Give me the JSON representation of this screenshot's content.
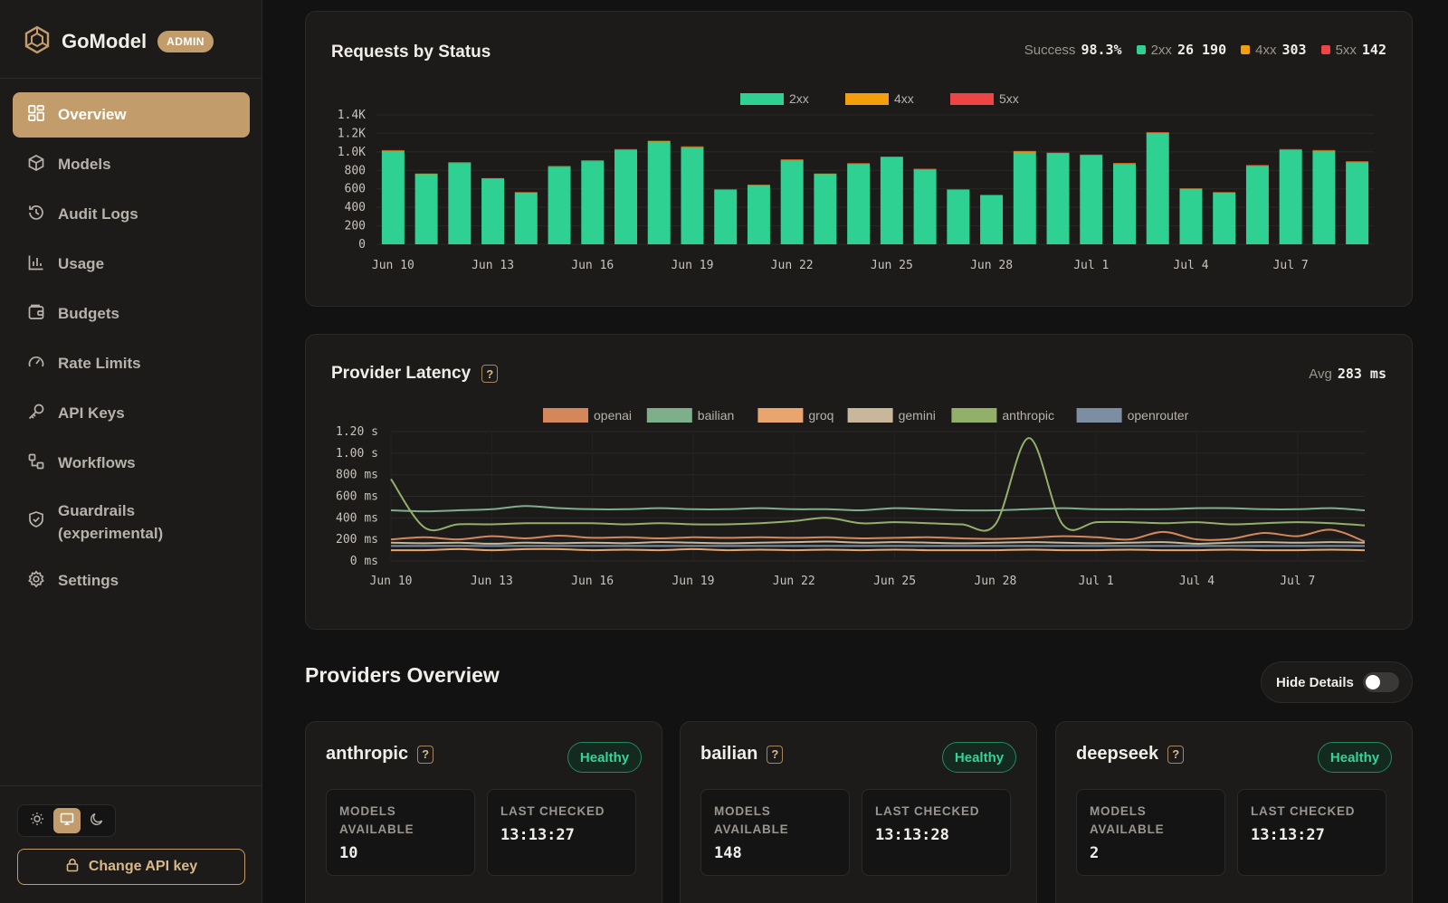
{
  "brand": {
    "name": "GoModel",
    "badge": "ADMIN"
  },
  "sidebar": {
    "items": [
      {
        "label": "Overview",
        "icon": "grid-icon",
        "active": true
      },
      {
        "label": "Models",
        "icon": "cube-icon"
      },
      {
        "label": "Audit Logs",
        "icon": "history-icon"
      },
      {
        "label": "Usage",
        "icon": "bar-chart-icon"
      },
      {
        "label": "Budgets",
        "icon": "wallet-icon"
      },
      {
        "label": "Rate Limits",
        "icon": "gauge-icon"
      },
      {
        "label": "API Keys",
        "icon": "key-icon"
      },
      {
        "label": "Workflows",
        "icon": "workflow-icon"
      },
      {
        "label": "Guardrails (experimental)",
        "line1": "Guardrails",
        "line2": "(experimental)",
        "icon": "shield-icon"
      },
      {
        "label": "Settings",
        "icon": "gear-icon"
      }
    ],
    "change_key_label": "Change API key"
  },
  "colors": {
    "accent": "#c39c6b",
    "s2xx": "#2ed192",
    "s4xx": "#f59e0b",
    "s5xx": "#ef4444"
  },
  "requests_card": {
    "title": "Requests by Status",
    "success_label": "Success",
    "success_value": "98.3%",
    "s2xx_label": "2xx",
    "s2xx_value": "26 190",
    "s4xx_label": "4xx",
    "s4xx_value": "303",
    "s5xx_label": "5xx",
    "s5xx_value": "142"
  },
  "latency_card": {
    "title": "Provider Latency",
    "help": "?",
    "avg_label": "Avg",
    "avg_value": "283 ms"
  },
  "chart_data": [
    {
      "type": "bar",
      "legend": [
        "2xx",
        "4xx",
        "5xx"
      ],
      "x_tick_labels": [
        "Jun 10",
        "Jun 13",
        "Jun 16",
        "Jun 19",
        "Jun 22",
        "Jun 25",
        "Jun 28",
        "Jul 1",
        "Jul 4",
        "Jul 7"
      ],
      "y_tick_labels": [
        "0",
        "200",
        "400",
        "600",
        "800",
        "1.0K",
        "1.2K",
        "1.4K"
      ],
      "ylim": [
        0,
        1400
      ],
      "categories": [
        "Jun 10",
        "Jun 11",
        "Jun 12",
        "Jun 13",
        "Jun 14",
        "Jun 15",
        "Jun 16",
        "Jun 17",
        "Jun 18",
        "Jun 19",
        "Jun 20",
        "Jun 21",
        "Jun 22",
        "Jun 23",
        "Jun 24",
        "Jun 25",
        "Jun 26",
        "Jun 27",
        "Jun 28",
        "Jun 29",
        "Jun 30",
        "Jul 1",
        "Jul 2",
        "Jul 3",
        "Jul 4",
        "Jul 5",
        "Jul 6",
        "Jul 7",
        "Jul 8",
        "Jul 9"
      ],
      "series": [
        {
          "name": "2xx",
          "values": [
            1010,
            760,
            880,
            710,
            560,
            840,
            900,
            1020,
            1110,
            1050,
            590,
            640,
            910,
            760,
            870,
            940,
            810,
            590,
            530,
            990,
            980,
            960,
            870,
            1200,
            600,
            560,
            850,
            1020,
            1010,
            890
          ]
        },
        {
          "name": "4xx",
          "values": [
            6,
            4,
            5,
            4,
            3,
            5,
            5,
            6,
            7,
            6,
            3,
            4,
            5,
            4,
            5,
            5,
            5,
            3,
            3,
            14,
            8,
            7,
            6,
            8,
            4,
            3,
            5,
            6,
            6,
            5
          ]
        },
        {
          "name": "5xx",
          "values": [
            3,
            2,
            3,
            2,
            2,
            3,
            3,
            4,
            4,
            4,
            2,
            2,
            3,
            2,
            3,
            3,
            3,
            2,
            2,
            6,
            4,
            4,
            3,
            5,
            2,
            2,
            3,
            4,
            4,
            3
          ]
        }
      ]
    },
    {
      "type": "line",
      "legend_placement": "top-center",
      "x_tick_labels": [
        "Jun 10",
        "Jun 13",
        "Jun 16",
        "Jun 19",
        "Jun 22",
        "Jun 25",
        "Jun 28",
        "Jul 1",
        "Jul 4",
        "Jul 7"
      ],
      "y_tick_labels": [
        "0 ms",
        "200 ms",
        "400 ms",
        "600 ms",
        "800 ms",
        "1.00 s",
        "1.20 s"
      ],
      "ylim": [
        0,
        1200
      ],
      "x": [
        "Jun 10",
        "Jun 11",
        "Jun 12",
        "Jun 13",
        "Jun 14",
        "Jun 15",
        "Jun 16",
        "Jun 17",
        "Jun 18",
        "Jun 19",
        "Jun 20",
        "Jun 21",
        "Jun 22",
        "Jun 23",
        "Jun 24",
        "Jun 25",
        "Jun 26",
        "Jun 27",
        "Jun 28",
        "Jun 29",
        "Jun 30",
        "Jul 1",
        "Jul 2",
        "Jul 3",
        "Jul 4",
        "Jul 5",
        "Jul 6",
        "Jul 7",
        "Jul 8",
        "Jul 9"
      ],
      "series": [
        {
          "name": "openai",
          "color": "#d4875a",
          "values": [
            200,
            220,
            200,
            230,
            210,
            235,
            215,
            220,
            210,
            220,
            215,
            220,
            215,
            220,
            210,
            215,
            220,
            210,
            205,
            215,
            230,
            220,
            200,
            270,
            200,
            205,
            260,
            230,
            290,
            180
          ]
        },
        {
          "name": "bailian",
          "color": "#7fae8a",
          "values": [
            470,
            460,
            470,
            480,
            510,
            490,
            480,
            480,
            490,
            480,
            480,
            490,
            480,
            480,
            470,
            490,
            480,
            470,
            470,
            480,
            490,
            480,
            480,
            480,
            490,
            490,
            480,
            480,
            490,
            470
          ]
        },
        {
          "name": "groq",
          "color": "#e8a66e",
          "values": [
            100,
            100,
            110,
            100,
            110,
            110,
            100,
            105,
            100,
            110,
            100,
            105,
            100,
            105,
            100,
            105,
            100,
            100,
            100,
            105,
            100,
            100,
            105,
            100,
            100,
            105,
            100,
            100,
            105,
            100
          ]
        },
        {
          "name": "gemini",
          "color": "#c8b79a",
          "values": [
            170,
            165,
            170,
            160,
            170,
            165,
            170,
            165,
            175,
            170,
            165,
            170,
            175,
            180,
            170,
            175,
            170,
            165,
            170,
            175,
            170,
            165,
            170,
            175,
            160,
            170,
            175,
            170,
            175,
            170
          ]
        },
        {
          "name": "anthropic",
          "color": "#93b06a",
          "values": [
            760,
            310,
            340,
            340,
            350,
            350,
            350,
            340,
            350,
            340,
            340,
            350,
            370,
            400,
            350,
            360,
            350,
            340,
            340,
            1140,
            340,
            360,
            360,
            350,
            360,
            340,
            350,
            360,
            350,
            330
          ]
        },
        {
          "name": "openrouter",
          "color": "#7d8ea3",
          "values": [
            140,
            140,
            140,
            140,
            140,
            140,
            140,
            140,
            140,
            140,
            140,
            140,
            140,
            140,
            140,
            140,
            140,
            140,
            140,
            140,
            140,
            140,
            140,
            140,
            140,
            140,
            140,
            140,
            140,
            140
          ]
        }
      ]
    }
  ],
  "providers_section": {
    "title": "Providers Overview",
    "hide_details_label": "Hide Details"
  },
  "providers": [
    {
      "name": "anthropic",
      "status": "Healthy",
      "models_label": "MODELS AVAILABLE",
      "models_line1": "MODELS",
      "models_line2": "AVAILABLE",
      "models_value": "10",
      "checked_label": "LAST CHECKED",
      "checked_value": "13:13:27"
    },
    {
      "name": "bailian",
      "status": "Healthy",
      "models_label": "MODELS AVAILABLE",
      "models_line1": "MODELS",
      "models_line2": "AVAILABLE",
      "models_value": "148",
      "checked_label": "LAST CHECKED",
      "checked_value": "13:13:28"
    },
    {
      "name": "deepseek",
      "status": "Healthy",
      "models_label": "MODELS AVAILABLE",
      "models_line1": "MODELS",
      "models_line2": "AVAILABLE",
      "models_value": "2",
      "checked_label": "LAST CHECKED",
      "checked_value": "13:13:27"
    }
  ]
}
